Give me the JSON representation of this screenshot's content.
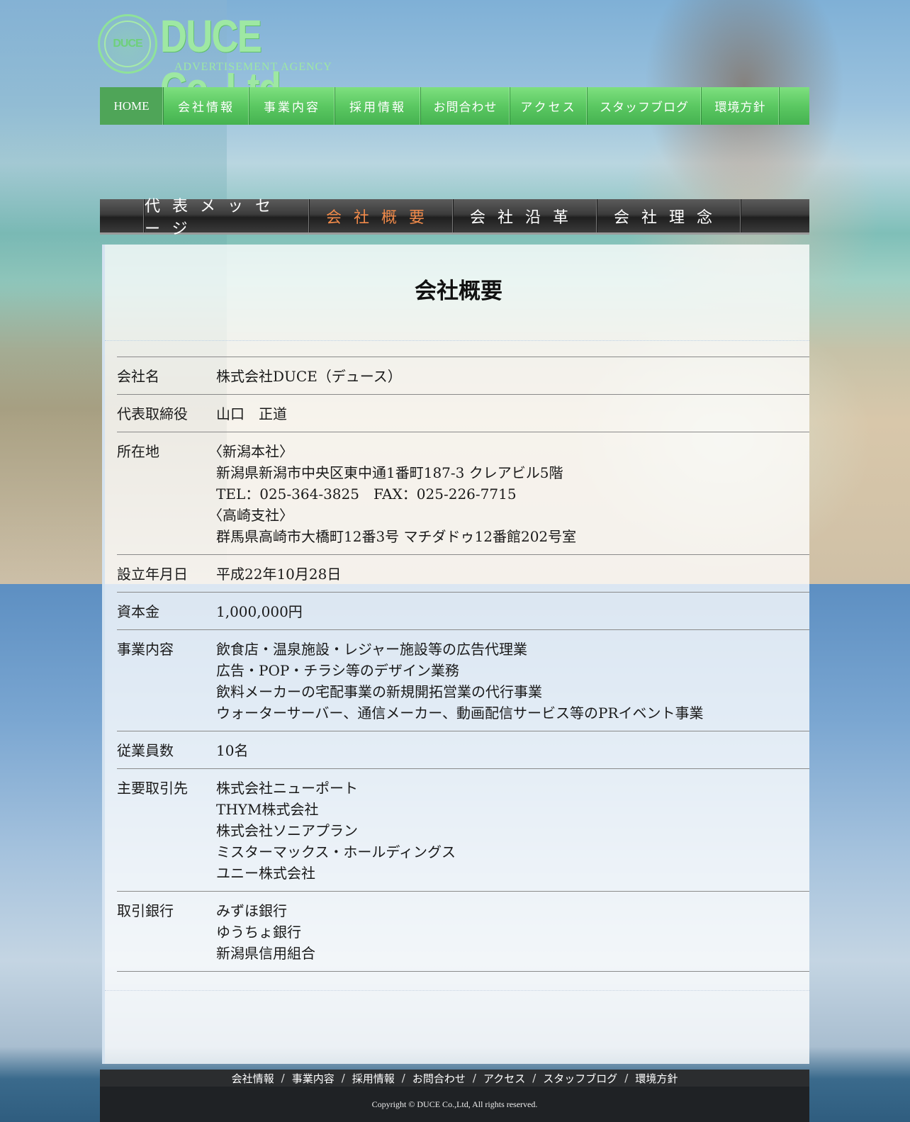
{
  "logo": {
    "emblem_text": "DUCE",
    "name": "DUCE Co.,Ltd.",
    "tagline": "ADVERTISEMENT AGENCY"
  },
  "global_nav": [
    {
      "label": "HOME"
    },
    {
      "label": "会社情報"
    },
    {
      "label": "事業内容"
    },
    {
      "label": "採用情報"
    },
    {
      "label": "お問合わせ"
    },
    {
      "label": "アクセス"
    },
    {
      "label": "スタッフブログ"
    },
    {
      "label": "環境方針"
    }
  ],
  "sub_nav": [
    {
      "label": "代表メッセージ",
      "active": false
    },
    {
      "label": "会社概要",
      "active": true
    },
    {
      "label": "会社沿革",
      "active": false
    },
    {
      "label": "会社理念",
      "active": false
    }
  ],
  "page": {
    "title": "会社概要"
  },
  "company_info": [
    {
      "label": "会社名",
      "lines": [
        "株式会社DUCE（デュース）"
      ]
    },
    {
      "label": "代表取締役",
      "lines": [
        "山口　正道"
      ]
    },
    {
      "label": "所在地",
      "lines": [
        "〈新潟本社〉",
        "新潟県新潟市中央区東中通1番町187-3 クレアビル5階",
        "TEL：025-364-3825　FAX：025-226-7715",
        "〈高崎支社〉",
        "群馬県高崎市大橋町12番3号 マチダドゥ12番館202号室"
      ]
    },
    {
      "label": "設立年月日",
      "lines": [
        "平成22年10月28日"
      ]
    },
    {
      "label": "資本金",
      "lines": [
        "1,000,000円"
      ]
    },
    {
      "label": "事業内容",
      "lines": [
        "飲食店・温泉施設・レジャー施設等の広告代理業",
        "広告・POP・チラシ等のデザイン業務",
        "飲料メーカーの宅配事業の新規開拓営業の代行事業",
        "ウォーターサーバー、通信メーカー、動画配信サービス等のPRイベント事業"
      ]
    },
    {
      "label": "従業員数",
      "lines": [
        "10名"
      ]
    },
    {
      "label": "主要取引先",
      "lines": [
        "株式会社ニューポート",
        "THYM株式会社",
        "株式会社ソニアプラン",
        "ミスターマックス・ホールディングス",
        "ユニー株式会社"
      ]
    },
    {
      "label": "取引銀行",
      "lines": [
        "みずほ銀行",
        "ゆうちょ銀行",
        "新潟県信用組合"
      ]
    }
  ],
  "footer": {
    "links": [
      "会社情報",
      "事業内容",
      "採用情報",
      "お問合わせ",
      "アクセス",
      "スタッフブログ",
      "環境方針"
    ],
    "separator": "/",
    "copyright": "Copyright © DUCE Co.,Ltd, All rights reserved."
  },
  "colors": {
    "nav_green": "#5bc862",
    "active_sub_nav": "#f08a4a",
    "footer_bg": "#1f2225"
  }
}
